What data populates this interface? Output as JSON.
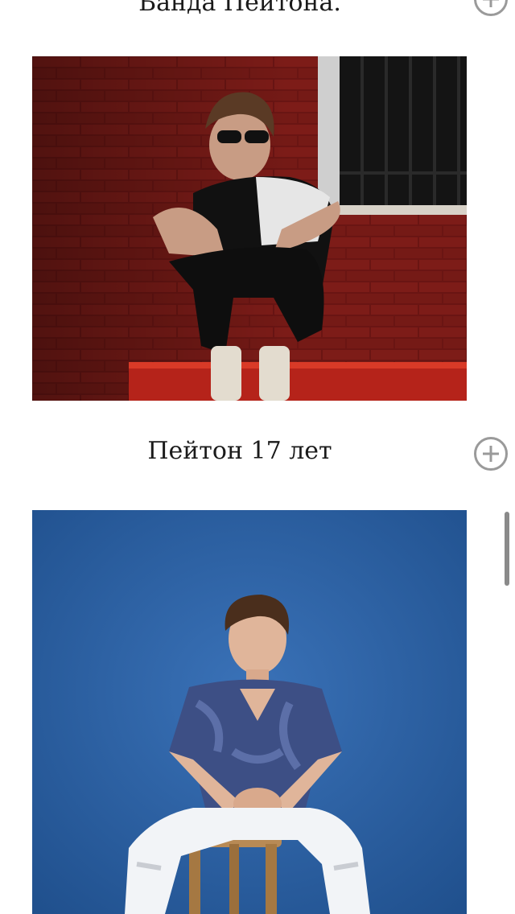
{
  "captions": {
    "top": "Банда Пейтона.",
    "middle": "Пейтон 17 лет"
  },
  "icons": {
    "expand": "plus-circle-icon"
  },
  "colors": {
    "icon_gray": "#9a9a9a",
    "text": "#1a1a1a",
    "photo1_wall": "#6e1614",
    "photo2_backdrop": "#2d5f9e"
  }
}
